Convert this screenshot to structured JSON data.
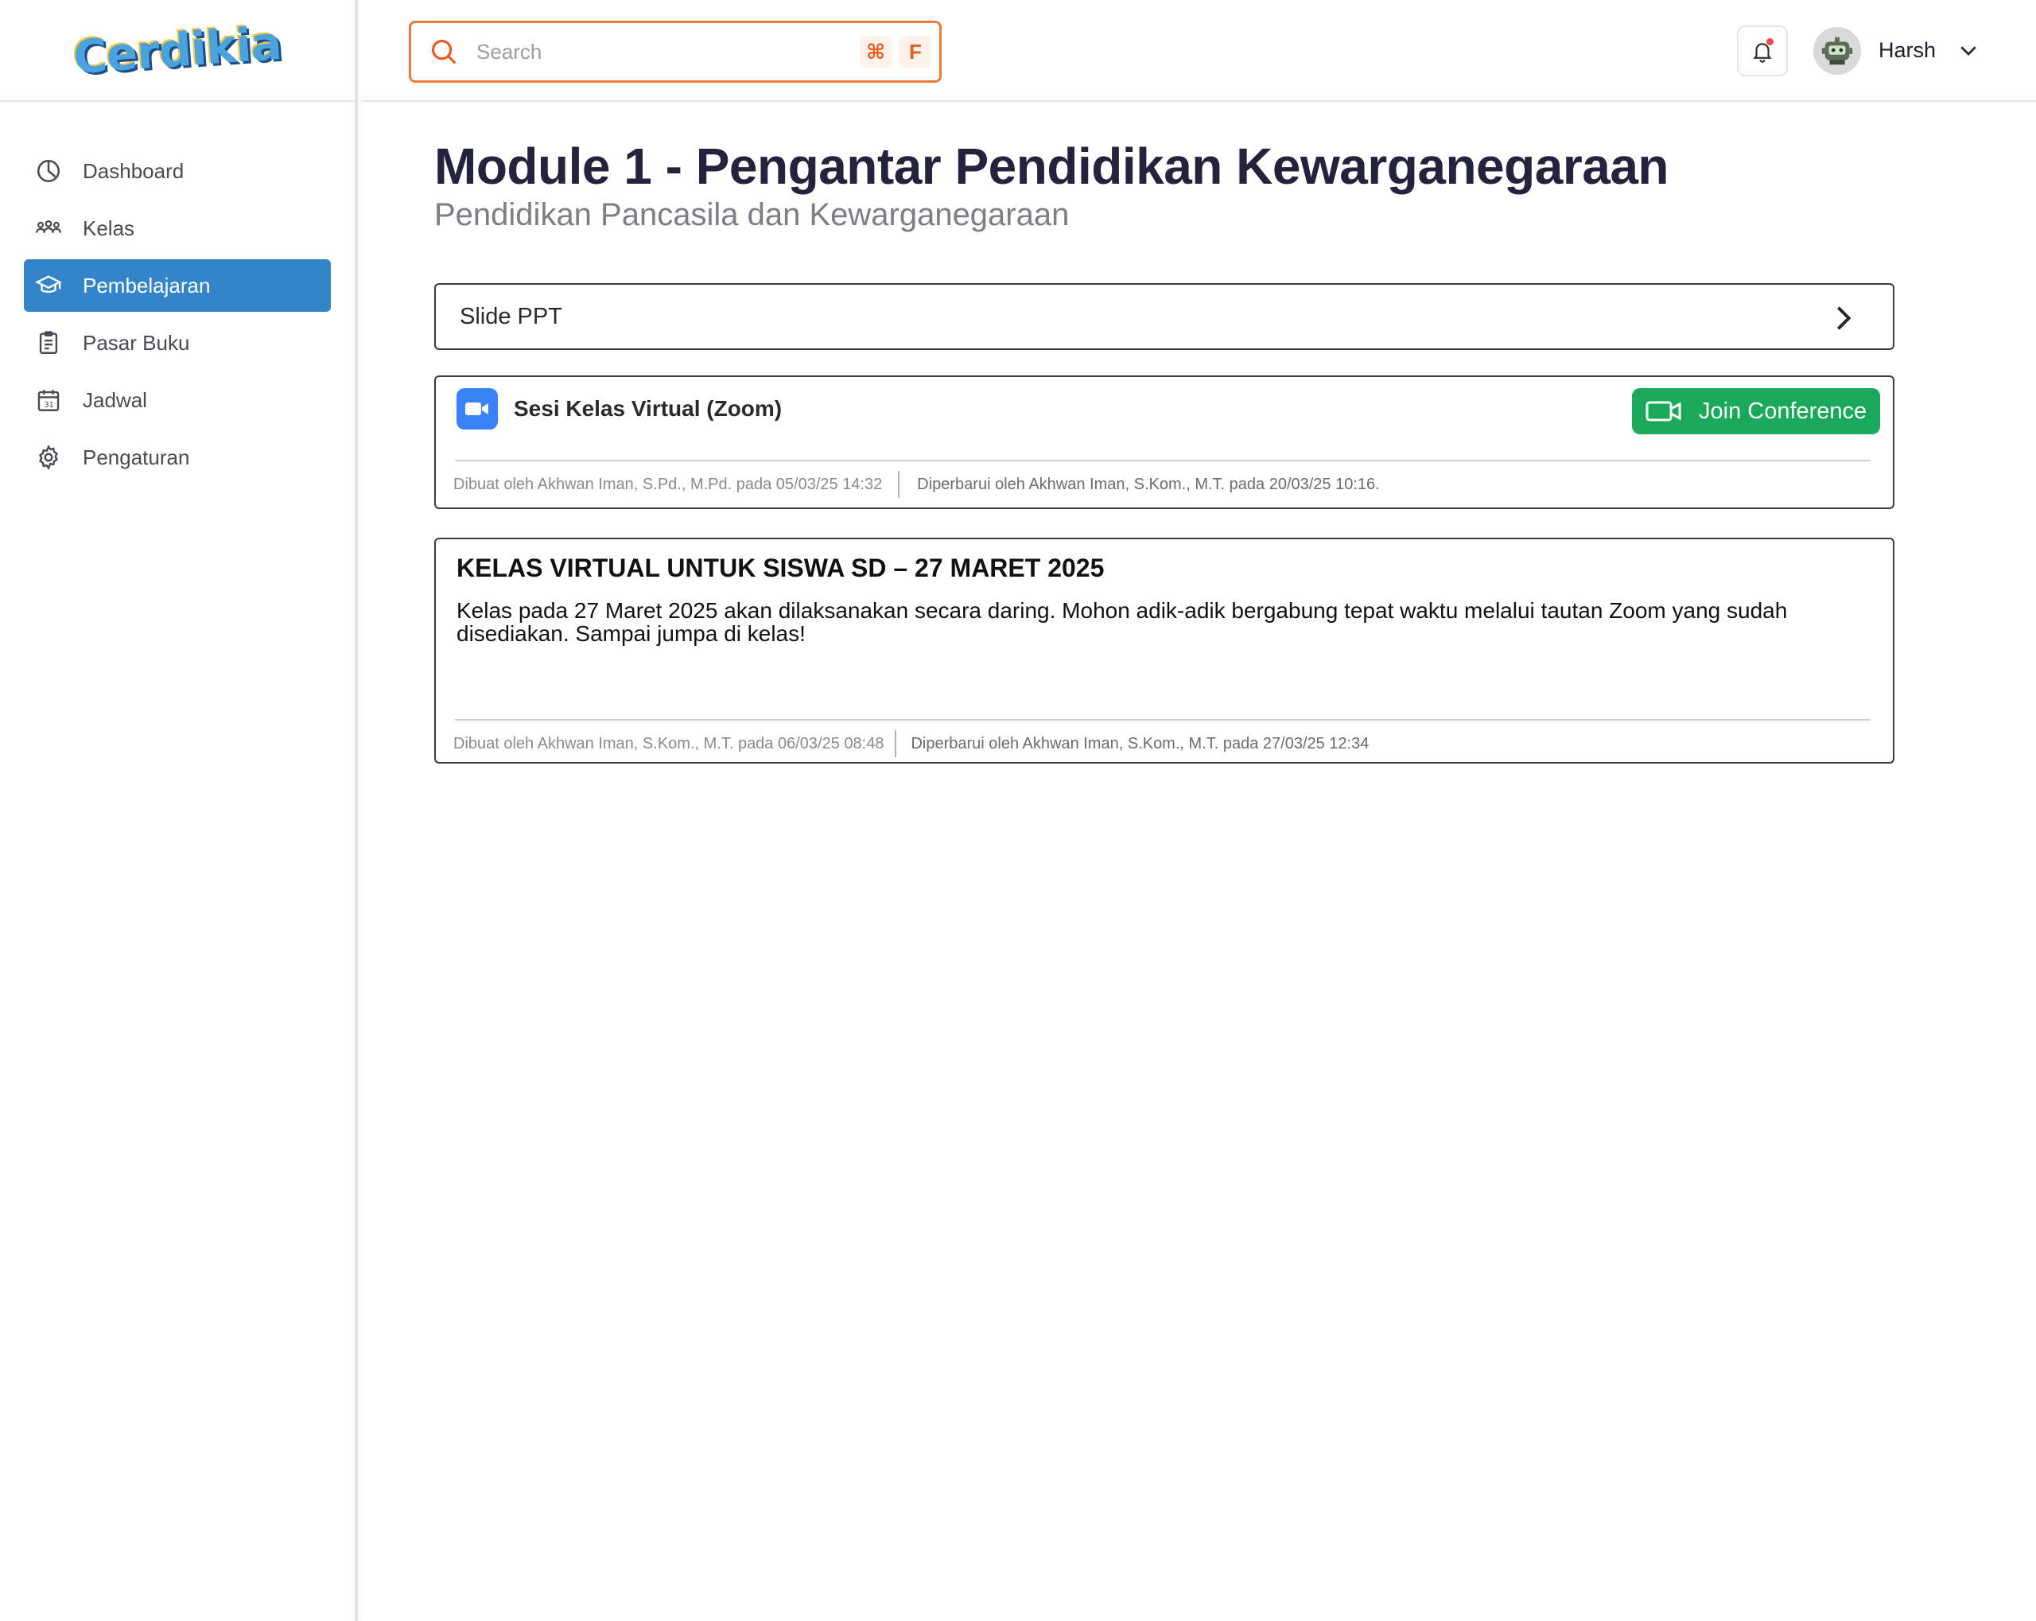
{
  "brand": {
    "logo_text": "Cerdikia"
  },
  "sidebar": {
    "items": [
      {
        "label": "Dashboard",
        "icon": "dashboard-icon",
        "active": false
      },
      {
        "label": "Kelas",
        "icon": "users-icon",
        "active": false
      },
      {
        "label": "Pembelajaran",
        "icon": "graduation-cap-icon",
        "active": true
      },
      {
        "label": "Pasar Buku",
        "icon": "clipboard-icon",
        "active": false
      },
      {
        "label": "Jadwal",
        "icon": "calendar-icon",
        "active": false
      },
      {
        "label": "Pengaturan",
        "icon": "gear-icon",
        "active": false
      }
    ]
  },
  "topbar": {
    "search": {
      "placeholder": "Search",
      "shortcut_symbol": "⌘",
      "shortcut_key": "F"
    },
    "user": {
      "name": "Harsh"
    }
  },
  "page": {
    "title": "Module 1 - Pengantar Pendidikan Kewarganegaraan",
    "subtitle": "Pendidikan Pancasila dan Kewarganegaraan"
  },
  "slide_item": {
    "label": "Slide PPT"
  },
  "zoom_session": {
    "title": "Sesi Kelas Virtual (Zoom)",
    "join_label": "Join Conference",
    "created": "Dibuat oleh Akhwan Iman, S.Pd., M.Pd. pada 05/03/25 14:32",
    "updated": "Diperbarui oleh Akhwan Iman, S.Kom., M.T. pada 20/03/25 10:16."
  },
  "announcement": {
    "title": "KELAS VIRTUAL UNTUK SISWA SD – 27 MARET 2025",
    "body": "Kelas pada 27 Maret 2025 akan dilaksanakan secara daring. Mohon adik-adik bergabung tepat waktu melalui tautan Zoom yang sudah disediakan. Sampai jumpa di kelas!",
    "created": "Dibuat oleh Akhwan Iman, S.Kom., M.T. pada 06/03/25 08:48",
    "updated": "Diperbarui oleh Akhwan Iman, S.Kom., M.T. pada 27/03/25 12:34"
  },
  "colors": {
    "accent_orange": "#f07a3c",
    "active_nav": "#3385c9",
    "join_green": "#1aa85a",
    "zoom_blue": "#3a82f7"
  }
}
